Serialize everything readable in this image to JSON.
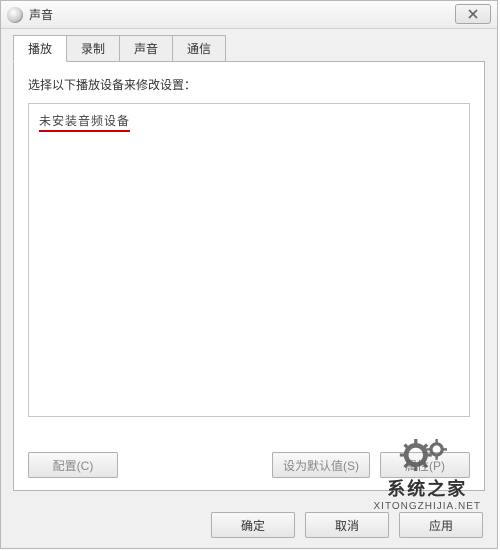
{
  "window": {
    "title": "声音"
  },
  "tabs": {
    "playback": "播放",
    "recording": "录制",
    "sounds": "声音",
    "communications": "通信"
  },
  "panel": {
    "instruction": "选择以下播放设备来修改设置：",
    "no_device": "未安装音频设备"
  },
  "panel_buttons": {
    "configure": "配置(C)",
    "set_default": "设为默认值(S)",
    "properties": "属性(P)"
  },
  "bottom_buttons": {
    "ok": "确定",
    "cancel": "取消",
    "apply": "应用"
  },
  "watermark": {
    "cn": "系统之家",
    "url": "XITONGZHIJIA.NET"
  }
}
